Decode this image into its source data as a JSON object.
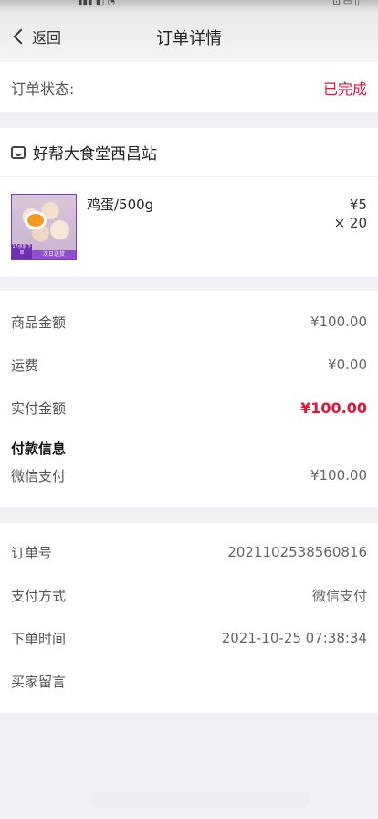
{
  "navbar": {
    "back_label": "返回",
    "title": "订单详情"
  },
  "status": {
    "label": "订单状态:",
    "value": "已完成"
  },
  "store": {
    "name": "好帮大食堂西昌站",
    "product": {
      "name": "鸡蛋/500g",
      "price": "¥5",
      "quantity": "× 20",
      "badge_left": "17点前下单",
      "badge_right": "次日送货"
    }
  },
  "amounts": {
    "goods_label": "商品金额",
    "goods_value": "¥100.00",
    "shipping_label": "运费",
    "shipping_value": "¥0.00",
    "paid_label": "实付金额",
    "paid_value": "¥100.00",
    "payment_info_title": "付款信息",
    "wechat_label": "微信支付",
    "wechat_value": "¥100.00"
  },
  "order_info": {
    "order_no_label": "订单号",
    "order_no_value": "2021102538560816",
    "pay_method_label": "支付方式",
    "pay_method_value": "微信支付",
    "time_label": "下单时间",
    "time_value": "2021-10-25 07:38:34",
    "message_label": "买家留言",
    "message_value": ""
  },
  "colors": {
    "accent": "#e4133a",
    "background": "#f1f0f4",
    "card": "#ffffff"
  }
}
